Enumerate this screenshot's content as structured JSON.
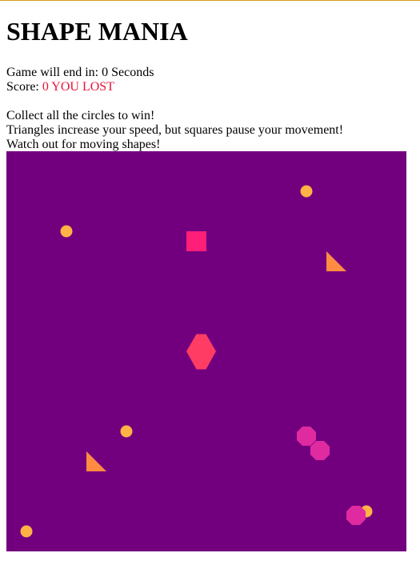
{
  "title": "SHAPE MANIA",
  "timer": {
    "prefix": "Game will end in: ",
    "seconds": "0",
    "suffix": " Seconds"
  },
  "score": {
    "label": "Score: ",
    "value": "0",
    "status": "YOU LOST"
  },
  "instructions": [
    "Collect all the circles to win!",
    "Triangles increase your speed, but squares pause your movement!",
    "Watch out for moving shapes!"
  ],
  "colors": {
    "board": "#72007e",
    "circle": "#ffb347",
    "triangle": "#ff8c42",
    "square": "#ff1e78",
    "hexagon": "#ff3c64",
    "octagon": "#e02aa0",
    "lost_text": "#e8143c"
  }
}
